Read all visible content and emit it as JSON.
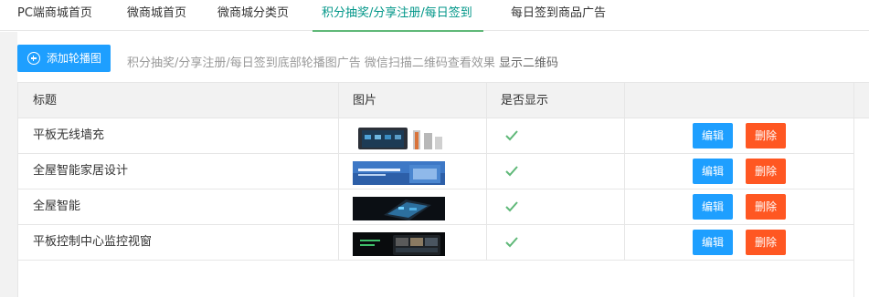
{
  "tabs": [
    {
      "label": "PC端商城首页",
      "active": false
    },
    {
      "label": "微商城首页",
      "active": false
    },
    {
      "label": "微商城分类页",
      "active": false
    },
    {
      "label": "积分抽奖/分享注册/每日签到",
      "active": true
    },
    {
      "label": "每日签到商品广告",
      "active": false
    }
  ],
  "toolbar": {
    "add_label": "添加轮播图",
    "add_icon": "plus-circle-icon",
    "hint": "积分抽奖/分享注册/每日签到底部轮播图广告 微信扫描二维码查看效果",
    "show_qr_label": "显示二维码"
  },
  "table": {
    "headers": {
      "title": "标题",
      "image": "图片",
      "visible": "是否显示"
    },
    "rows": [
      {
        "title": "平板无线墙充",
        "visible": true,
        "thumb": "tablet-wall-charger-thumbnail",
        "edit_label": "编辑",
        "delete_label": "删除"
      },
      {
        "title": "全屋智能家居设计",
        "visible": true,
        "thumb": "smart-home-design-thumbnail",
        "edit_label": "编辑",
        "delete_label": "删除"
      },
      {
        "title": "全屋智能",
        "visible": true,
        "thumb": "smart-home-thumbnail",
        "edit_label": "编辑",
        "delete_label": "删除"
      },
      {
        "title": "平板控制中心监控视窗",
        "visible": true,
        "thumb": "tablet-control-center-thumbnail",
        "edit_label": "编辑",
        "delete_label": "删除"
      }
    ]
  },
  "colors": {
    "primary_blue": "#1e9fff",
    "danger_orange": "#ff5722",
    "active_tab_text": "#009688",
    "active_tab_underline": "#5fb878",
    "check_green": "#5fb878"
  }
}
